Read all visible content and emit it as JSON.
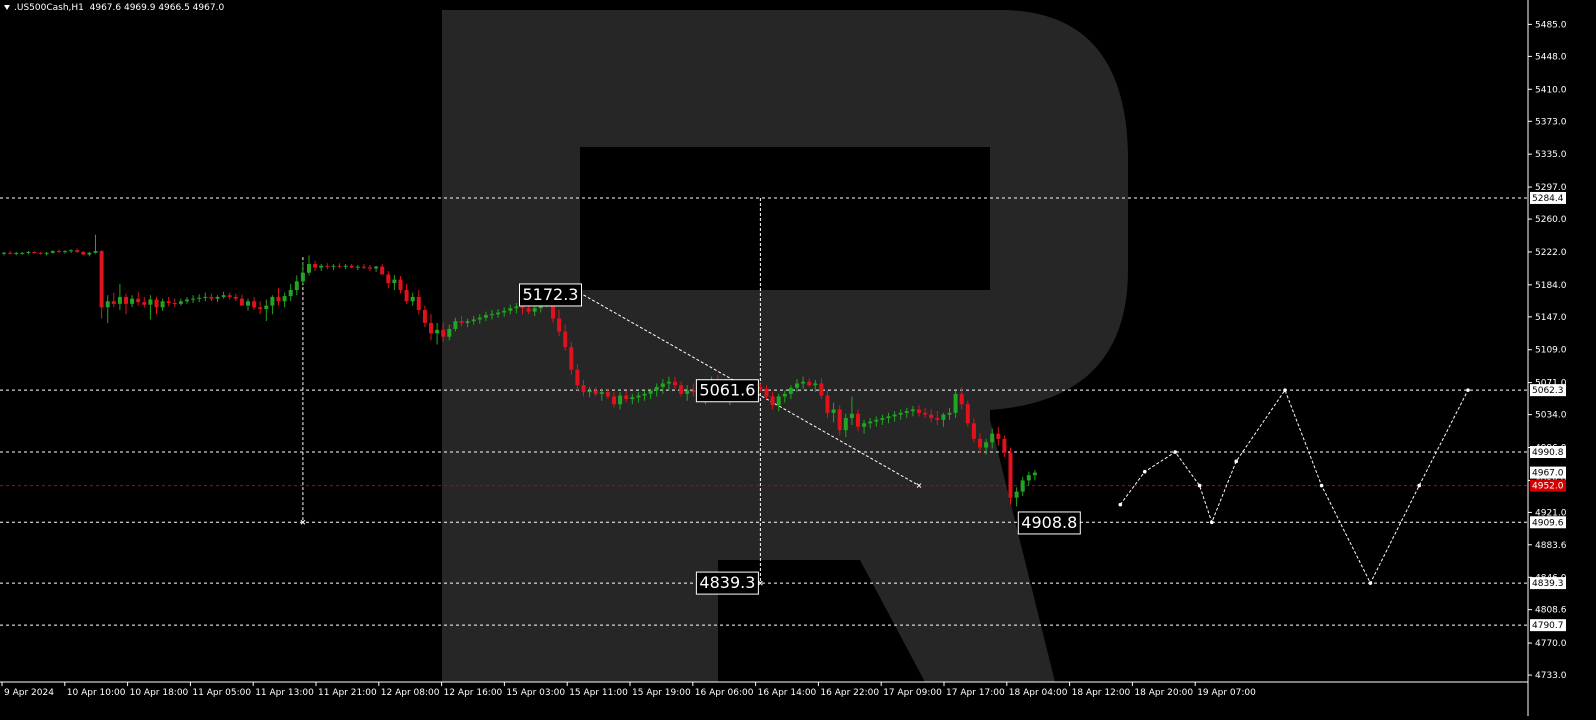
{
  "header": {
    "symbol": ".US500Cash,H1",
    "ohlc": "4967.6 4969.9 4966.5 4967.0"
  },
  "colors": {
    "background": "#000000",
    "watermark": "#262626",
    "bull": "#21a621",
    "bear": "#e0121b",
    "forecast_line": "#ffffff",
    "current_price_line": "#c80000",
    "axis_text": "#ffffff",
    "label_bg": "#ffffff",
    "label_text": "#000000",
    "current_label_bg": "#d00000"
  },
  "chart_data": {
    "type": "candlestick",
    "timeframe": "H1",
    "y_axis_ticks": [
      "5485.0",
      "5448.0",
      "5410.0",
      "5373.0",
      "5335.0",
      "5297.0",
      "5260.0",
      "5222.0",
      "5184.0",
      "5147.0",
      "5109.0",
      "5071.0",
      "5034.0",
      "4996.0",
      "4958.0",
      "4921.0",
      "4883.6",
      "4846.0",
      "4808.6",
      "4770.0",
      "4733.0"
    ],
    "ylim": [
      4733.0,
      5485.0
    ],
    "x_axis_labels": [
      "9 Apr 2024",
      "10 Apr 10:00",
      "10 Apr 18:00",
      "11 Apr 05:00",
      "11 Apr 13:00",
      "11 Apr 21:00",
      "12 Apr 08:00",
      "12 Apr 16:00",
      "15 Apr 03:00",
      "15 Apr 11:00",
      "15 Apr 19:00",
      "16 Apr 06:00",
      "16 Apr 14:00",
      "16 Apr 22:00",
      "17 Apr 09:00",
      "17 Apr 17:00",
      "18 Apr 04:00",
      "18 Apr 12:00",
      "18 Apr 20:00",
      "19 Apr 07:00"
    ],
    "levels": [
      {
        "price": 5284.4,
        "label": "5284.4"
      },
      {
        "price": 5062.3,
        "label": "5062.3"
      },
      {
        "price": 4990.8,
        "label": "4990.8"
      },
      {
        "price": 4909.6,
        "label": "4909.6"
      },
      {
        "price": 4839.3,
        "label": "4839.3"
      },
      {
        "price": 4790.7,
        "label": "4790.7"
      }
    ],
    "current_price": {
      "price": 4952.0,
      "label": "4952.0"
    },
    "current_quote_label": "4967.0",
    "annotations": [
      {
        "text": "5172.3",
        "price": 5172.3,
        "bar": 95
      },
      {
        "text": "5061.6",
        "price": 5061.6,
        "bar": 124
      },
      {
        "text": "4908.8",
        "price": 4908.8,
        "bar": 183
      },
      {
        "text": "4839.3",
        "price": 4839.3,
        "bar": 124
      }
    ],
    "candles": [
      [
        5220,
        5222,
        5218,
        5221
      ],
      [
        5221,
        5223,
        5219,
        5220
      ],
      [
        5220,
        5222,
        5218,
        5221
      ],
      [
        5221,
        5222,
        5219,
        5221
      ],
      [
        5221,
        5223,
        5219,
        5222
      ],
      [
        5222,
        5223,
        5220,
        5221
      ],
      [
        5221,
        5222,
        5219,
        5220
      ],
      [
        5220,
        5222,
        5218,
        5221
      ],
      [
        5221,
        5224,
        5220,
        5223
      ],
      [
        5223,
        5225,
        5221,
        5222
      ],
      [
        5222,
        5224,
        5220,
        5223
      ],
      [
        5223,
        5225,
        5221,
        5224
      ],
      [
        5224,
        5226,
        5221,
        5222
      ],
      [
        5222,
        5223,
        5218,
        5219
      ],
      [
        5219,
        5222,
        5217,
        5221
      ],
      [
        5221,
        5242,
        5220,
        5223
      ],
      [
        5223,
        5224,
        5145,
        5158
      ],
      [
        5158,
        5172,
        5140,
        5165
      ],
      [
        5165,
        5175,
        5158,
        5162
      ],
      [
        5162,
        5185,
        5155,
        5170
      ],
      [
        5170,
        5174,
        5150,
        5162
      ],
      [
        5162,
        5172,
        5158,
        5168
      ],
      [
        5168,
        5176,
        5160,
        5164
      ],
      [
        5164,
        5170,
        5158,
        5161
      ],
      [
        5161,
        5172,
        5144,
        5167
      ],
      [
        5167,
        5170,
        5150,
        5158
      ],
      [
        5158,
        5168,
        5154,
        5165
      ],
      [
        5165,
        5170,
        5159,
        5163
      ],
      [
        5163,
        5168,
        5158,
        5162
      ],
      [
        5162,
        5168,
        5160,
        5165
      ],
      [
        5165,
        5170,
        5162,
        5167
      ],
      [
        5167,
        5172,
        5163,
        5168
      ],
      [
        5168,
        5173,
        5164,
        5169
      ],
      [
        5169,
        5175,
        5165,
        5170
      ],
      [
        5170,
        5174,
        5165,
        5168
      ],
      [
        5168,
        5172,
        5164,
        5170
      ],
      [
        5170,
        5176,
        5168,
        5172
      ],
      [
        5172,
        5175,
        5167,
        5170
      ],
      [
        5170,
        5174,
        5165,
        5168
      ],
      [
        5168,
        5173,
        5163,
        5160
      ],
      [
        5160,
        5168,
        5154,
        5165
      ],
      [
        5165,
        5170,
        5155,
        5158
      ],
      [
        5158,
        5165,
        5150,
        5156
      ],
      [
        5156,
        5167,
        5142,
        5160
      ],
      [
        5160,
        5172,
        5150,
        5170
      ],
      [
        5170,
        5180,
        5160,
        5165
      ],
      [
        5165,
        5175,
        5158,
        5171
      ],
      [
        5171,
        5185,
        5165,
        5178
      ],
      [
        5178,
        5195,
        5172,
        5188
      ],
      [
        5188,
        5210,
        5185,
        5198
      ],
      [
        5198,
        5218,
        5195,
        5208
      ],
      [
        5208,
        5212,
        5200,
        5204
      ],
      [
        5204,
        5208,
        5200,
        5206
      ],
      [
        5206,
        5209,
        5202,
        5205
      ],
      [
        5205,
        5208,
        5201,
        5206
      ],
      [
        5206,
        5209,
        5203,
        5205
      ],
      [
        5205,
        5208,
        5202,
        5206
      ],
      [
        5206,
        5208,
        5203,
        5204
      ],
      [
        5204,
        5207,
        5201,
        5205
      ],
      [
        5205,
        5208,
        5202,
        5204
      ],
      [
        5204,
        5207,
        5200,
        5203
      ],
      [
        5203,
        5206,
        5199,
        5205
      ],
      [
        5205,
        5208,
        5200,
        5196
      ],
      [
        5196,
        5200,
        5180,
        5186
      ],
      [
        5186,
        5195,
        5178,
        5190
      ],
      [
        5190,
        5194,
        5174,
        5178
      ],
      [
        5178,
        5185,
        5162,
        5165
      ],
      [
        5165,
        5175,
        5160,
        5170
      ],
      [
        5170,
        5178,
        5150,
        5155
      ],
      [
        5155,
        5160,
        5135,
        5140
      ],
      [
        5140,
        5150,
        5120,
        5128
      ],
      [
        5128,
        5140,
        5115,
        5132
      ],
      [
        5132,
        5140,
        5118,
        5124
      ],
      [
        5124,
        5138,
        5120,
        5133
      ],
      [
        5133,
        5146,
        5130,
        5142
      ],
      [
        5142,
        5148,
        5136,
        5140
      ],
      [
        5140,
        5145,
        5135,
        5142
      ],
      [
        5142,
        5148,
        5138,
        5144
      ],
      [
        5144,
        5150,
        5139,
        5146
      ],
      [
        5146,
        5153,
        5142,
        5149
      ],
      [
        5149,
        5155,
        5144,
        5150
      ],
      [
        5150,
        5156,
        5146,
        5152
      ],
      [
        5152,
        5158,
        5147,
        5154
      ],
      [
        5154,
        5161,
        5150,
        5157
      ],
      [
        5157,
        5163,
        5151,
        5159
      ],
      [
        5159,
        5164,
        5150,
        5157
      ],
      [
        5157,
        5162,
        5150,
        5153
      ],
      [
        5153,
        5160,
        5148,
        5157
      ],
      [
        5157,
        5168,
        5152,
        5165
      ],
      [
        5165,
        5175,
        5158,
        5172
      ],
      [
        5172,
        5176,
        5140,
        5145
      ],
      [
        5145,
        5155,
        5125,
        5130
      ],
      [
        5130,
        5138,
        5108,
        5112
      ],
      [
        5112,
        5118,
        5080,
        5086
      ],
      [
        5086,
        5092,
        5062,
        5068
      ],
      [
        5068,
        5074,
        5055,
        5060
      ],
      [
        5060,
        5066,
        5054,
        5062
      ],
      [
        5062,
        5066,
        5055,
        5058
      ],
      [
        5058,
        5064,
        5050,
        5060
      ],
      [
        5060,
        5064,
        5052,
        5055
      ],
      [
        5055,
        5060,
        5042,
        5046
      ],
      [
        5046,
        5060,
        5040,
        5056
      ],
      [
        5056,
        5062,
        5048,
        5052
      ],
      [
        5052,
        5058,
        5046,
        5054
      ],
      [
        5054,
        5060,
        5048,
        5056
      ],
      [
        5056,
        5062,
        5050,
        5058
      ],
      [
        5058,
        5064,
        5052,
        5062
      ],
      [
        5062,
        5070,
        5055,
        5066
      ],
      [
        5066,
        5075,
        5058,
        5070
      ],
      [
        5070,
        5078,
        5062,
        5072
      ],
      [
        5072,
        5078,
        5064,
        5068
      ],
      [
        5068,
        5072,
        5055,
        5058
      ],
      [
        5058,
        5068,
        5050,
        5062
      ],
      [
        5062,
        5070,
        5055,
        5060
      ],
      [
        5060,
        5068,
        5050,
        5055
      ],
      [
        5055,
        5065,
        5046,
        5060
      ],
      [
        5060,
        5078,
        5055,
        5070
      ],
      [
        5070,
        5080,
        5060,
        5064
      ],
      [
        5064,
        5070,
        5048,
        5052
      ],
      [
        5052,
        5066,
        5045,
        5062
      ],
      [
        5062,
        5068,
        5055,
        5065
      ],
      [
        5065,
        5070,
        5058,
        5066
      ],
      [
        5066,
        5070,
        5060,
        5064
      ],
      [
        5064,
        5068,
        5058,
        5066
      ],
      [
        5066,
        5070,
        5060,
        5064
      ],
      [
        5064,
        5068,
        5052,
        5055
      ],
      [
        5055,
        5060,
        5040,
        5045
      ],
      [
        5045,
        5058,
        5038,
        5055
      ],
      [
        5055,
        5062,
        5048,
        5058
      ],
      [
        5058,
        5068,
        5052,
        5065
      ],
      [
        5065,
        5075,
        5060,
        5070
      ],
      [
        5070,
        5078,
        5064,
        5072
      ],
      [
        5072,
        5076,
        5066,
        5068
      ],
      [
        5068,
        5074,
        5060,
        5070
      ],
      [
        5070,
        5076,
        5052,
        5056
      ],
      [
        5056,
        5062,
        5030,
        5036
      ],
      [
        5036,
        5048,
        5025,
        5040
      ],
      [
        5040,
        5045,
        5010,
        5016
      ],
      [
        5016,
        5035,
        5008,
        5030
      ],
      [
        5030,
        5055,
        5022,
        5035
      ],
      [
        5035,
        5040,
        5015,
        5020
      ],
      [
        5020,
        5028,
        5012,
        5024
      ],
      [
        5024,
        5030,
        5018,
        5026
      ],
      [
        5026,
        5032,
        5020,
        5028
      ],
      [
        5028,
        5034,
        5022,
        5030
      ],
      [
        5030,
        5036,
        5024,
        5032
      ],
      [
        5032,
        5038,
        5026,
        5034
      ],
      [
        5034,
        5040,
        5028,
        5036
      ],
      [
        5036,
        5042,
        5030,
        5038
      ],
      [
        5038,
        5044,
        5032,
        5040
      ],
      [
        5040,
        5045,
        5032,
        5036
      ],
      [
        5036,
        5042,
        5030,
        5034
      ],
      [
        5034,
        5040,
        5025,
        5030
      ],
      [
        5030,
        5038,
        5022,
        5028
      ],
      [
        5028,
        5036,
        5020,
        5034
      ],
      [
        5034,
        5042,
        5028,
        5036
      ],
      [
        5036,
        5062,
        5030,
        5058
      ],
      [
        5058,
        5066,
        5040,
        5046
      ],
      [
        5046,
        5050,
        5020,
        5024
      ],
      [
        5024,
        5030,
        5002,
        5006
      ],
      [
        5006,
        5012,
        4990,
        4996
      ],
      [
        4996,
        5006,
        4988,
        5002
      ],
      [
        5002,
        5018,
        4995,
        5012
      ],
      [
        5012,
        5020,
        4998,
        5006
      ],
      [
        5006,
        5010,
        4985,
        4990
      ],
      [
        4990,
        4996,
        4930,
        4938
      ],
      [
        4938,
        4950,
        4928,
        4945
      ],
      [
        4945,
        4962,
        4940,
        4958
      ],
      [
        4958,
        4968,
        4952,
        4964
      ],
      [
        4964,
        4970,
        4958,
        4967
      ]
    ],
    "forecast_path": [
      {
        "bar": 183,
        "price": 4930.0
      },
      {
        "bar": 187,
        "price": 4968.0
      },
      {
        "bar": 192,
        "price": 4990.8
      },
      {
        "bar": 196,
        "price": 4952.0
      },
      {
        "bar": 198,
        "price": 4909.6
      },
      {
        "bar": 202,
        "price": 4980.0
      },
      {
        "bar": 210,
        "price": 5062.3
      },
      {
        "bar": 216,
        "price": 4952.0
      },
      {
        "bar": 224,
        "price": 4839.3
      },
      {
        "bar": 232,
        "price": 4952.0
      },
      {
        "bar": 240,
        "price": 5062.3
      }
    ],
    "guide_lines": [
      {
        "from": {
          "bar": 95,
          "price": 5172.3
        },
        "to": {
          "bar": 150,
          "price": 4952.0
        }
      },
      {
        "from": {
          "bar": 49,
          "price": 5216.0
        },
        "to": {
          "bar": 49,
          "price": 4909.6
        }
      },
      {
        "from": {
          "bar": 124,
          "price": 5284.4
        },
        "to": {
          "bar": 124,
          "price": 4839.3
        }
      }
    ]
  }
}
